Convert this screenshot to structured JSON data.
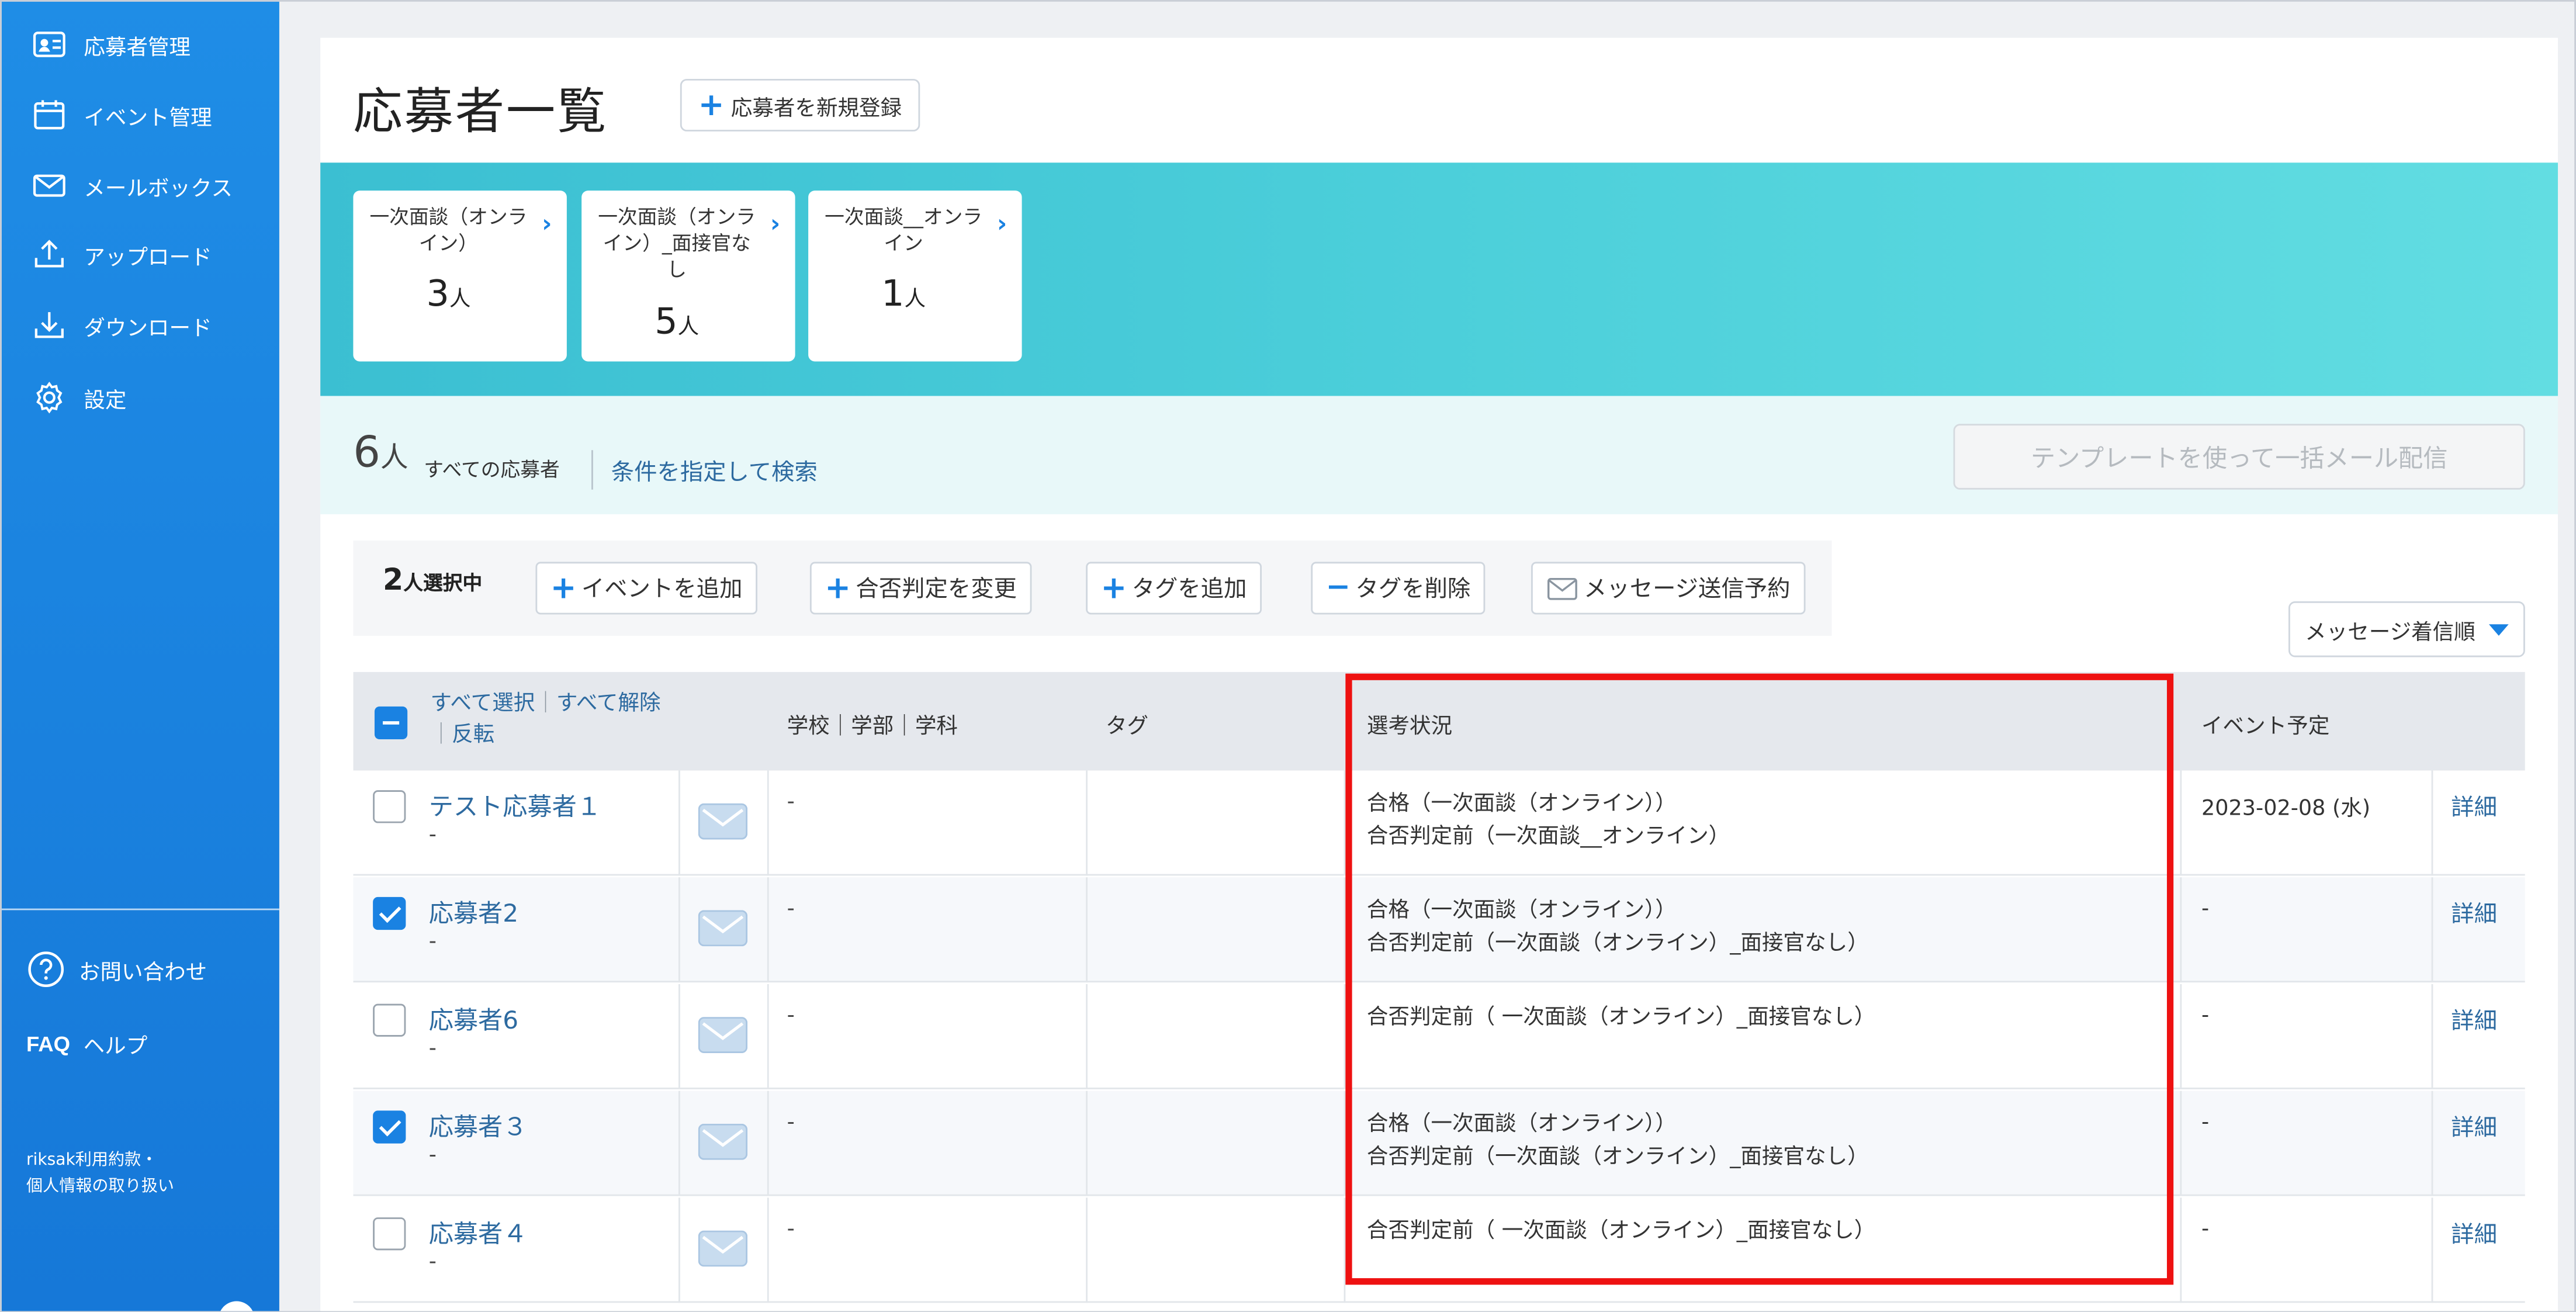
{
  "sidebar": {
    "items": [
      {
        "label": "応募者管理",
        "icon": "id-card-icon"
      },
      {
        "label": "イベント管理",
        "icon": "calendar-icon"
      },
      {
        "label": "メールボックス",
        "icon": "mail-icon"
      },
      {
        "label": "アップロード",
        "icon": "upload-icon"
      },
      {
        "label": "ダウンロード",
        "icon": "download-icon"
      },
      {
        "label": "設定",
        "icon": "gear-icon"
      }
    ],
    "contact": "お問い合わせ",
    "help_badge": "FAQ",
    "help": "ヘルプ",
    "terms_line1": "riksak利用約款・",
    "terms_line2": "個人情報の取り扱い"
  },
  "header": {
    "title": "応募者一覧",
    "new_button": "応募者を新規登録"
  },
  "stages": [
    {
      "name": "一次面談（オンライン）",
      "count": "3",
      "unit": "人"
    },
    {
      "name": "一次面談（オンライン）_面接官なし",
      "count": "5",
      "unit": "人"
    },
    {
      "name": "一次面談__オンライン",
      "count": "1",
      "unit": "人"
    }
  ],
  "summary": {
    "count": "6",
    "unit": "人",
    "label": "すべての応募者",
    "search_link": "条件を指定して検索",
    "bulk_mail": "テンプレートを使って一括メール配信"
  },
  "actions": {
    "selected_count": "2",
    "selected_label": "人選択中",
    "add_event": "イベントを追加",
    "change_result": "合否判定を変更",
    "add_tag": "タグを追加",
    "remove_tag": "タグを削除",
    "schedule_message": "メッセージ送信予約"
  },
  "sort": {
    "selected": "メッセージ着信順"
  },
  "table": {
    "select_all": "すべて選択",
    "deselect_all": "すべて解除",
    "invert": "反転",
    "columns": {
      "school": "学校｜学部｜学科",
      "tag": "タグ",
      "status": "選考状況",
      "event": "イベント予定"
    },
    "rows": [
      {
        "name": "テスト応募者１",
        "sub": "-",
        "school": "-",
        "status1": "合格（一次面談（オンライン））",
        "status2": "合否判定前（一次面談__オンライン）",
        "event": "2023-02-08 (水)",
        "detail": "詳細",
        "checked": false
      },
      {
        "name": "応募者2",
        "sub": "-",
        "school": "-",
        "status1": "合格（一次面談（オンライン））",
        "status2": "合否判定前（一次面談（オンライン）_面接官なし）",
        "event": "-",
        "detail": "詳細",
        "checked": true
      },
      {
        "name": "応募者6",
        "sub": "-",
        "school": "-",
        "status1": "合否判定前（ 一次面談（オンライン）_面接官なし）",
        "status2": "",
        "event": "-",
        "detail": "詳細",
        "checked": false
      },
      {
        "name": "応募者３",
        "sub": "-",
        "school": "-",
        "status1": "合格（一次面談（オンライン））",
        "status2": "合否判定前（一次面談（オンライン）_面接官なし）",
        "event": "-",
        "detail": "詳細",
        "checked": true
      },
      {
        "name": "応募者４",
        "sub": "-",
        "school": "-",
        "status1": "合否判定前（ 一次面談（オンライン）_面接官なし）",
        "status2": "",
        "event": "-",
        "detail": "詳細",
        "checked": false
      }
    ]
  },
  "colors": {
    "sidebar": "#1f8de6",
    "accent": "#1a82e2",
    "link": "#2d6aa0",
    "banner": "#4ccfda",
    "highlight": "#ee1111"
  }
}
